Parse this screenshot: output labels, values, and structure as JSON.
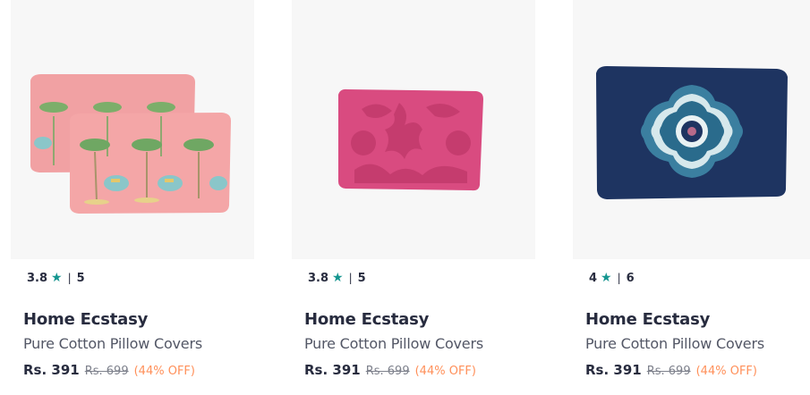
{
  "products": [
    {
      "image_alt": "pink pillow covers with palm trees and elephants",
      "rating": "3.8",
      "star_icon": "star-icon",
      "rating_count": "5",
      "brand": "Home Ecstasy",
      "product_name": "Pure Cotton Pillow Covers",
      "price": "Rs. 391",
      "mrp": "Rs. 699",
      "discount": "(44% OFF)"
    },
    {
      "image_alt": "pink damask pillow cover",
      "rating": "3.8",
      "star_icon": "star-icon",
      "rating_count": "5",
      "brand": "Home Ecstasy",
      "product_name": "Pure Cotton Pillow Covers",
      "price": "Rs. 391",
      "mrp": "Rs. 699",
      "discount": "(44% OFF)"
    },
    {
      "image_alt": "navy pillow cover with medallion",
      "rating": "4",
      "star_icon": "star-icon",
      "rating_count": "6",
      "brand": "Home Ecstasy",
      "product_name": "Pure Cotton Pillow Covers",
      "price": "Rs. 391",
      "mrp": "Rs. 699",
      "discount": "(44% OFF)"
    }
  ],
  "colors": {
    "star": "#14958f",
    "discount": "#ff905a",
    "pink_pillow": "#f4a3a5",
    "damask_pillow": "#d84a7e",
    "navy_pillow": "#1e3461"
  }
}
